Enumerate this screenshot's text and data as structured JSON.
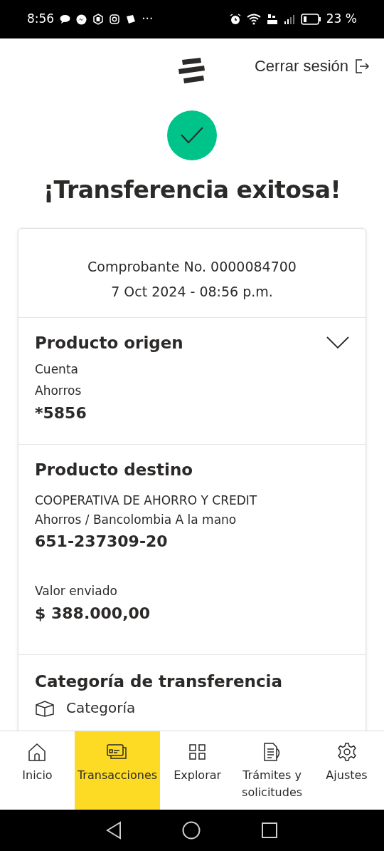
{
  "status_bar": {
    "time": "8:56",
    "more": "···",
    "battery": "23 %"
  },
  "header": {
    "logout": "Cerrar sesión"
  },
  "title": "¡Transferencia exitosa!",
  "receipt": {
    "number": "Comprobante No. 0000084700",
    "datetime": "7 Oct 2024 - 08:56 p.m."
  },
  "origin": {
    "title": "Producto origen",
    "expanded": false,
    "type": "Cuenta",
    "subtype": "Ahorros",
    "account": "*5856"
  },
  "destination": {
    "title": "Producto destino",
    "name": "COOPERATIVA DE AHORRO Y CREDIT",
    "product": "Ahorros / Bancolombia A la mano",
    "account": "651-237309-20",
    "amount_label": "Valor enviado",
    "amount": "$ 388.000,00"
  },
  "category": {
    "title": "Categoría de transferencia",
    "label": "Categoría"
  },
  "nav": [
    {
      "kind": "home",
      "label": "Inicio",
      "selected": false
    },
    {
      "kind": "cards",
      "label": "Transacciones",
      "selected": true
    },
    {
      "kind": "grid",
      "label": "Explorar",
      "selected": false
    },
    {
      "kind": "docs",
      "label": "Trámites y solicitudes",
      "selected": false
    },
    {
      "kind": "gear",
      "label": "Ajustes",
      "selected": false
    }
  ]
}
